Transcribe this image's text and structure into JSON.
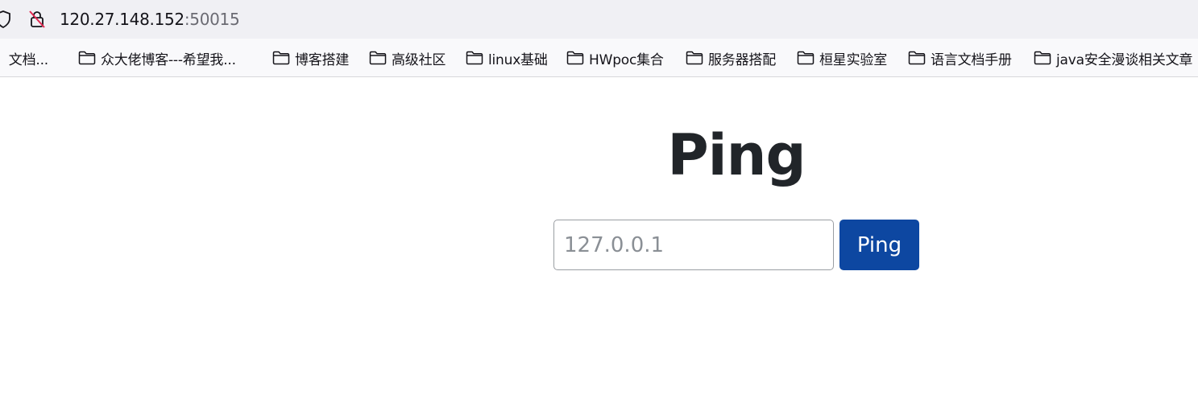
{
  "browser": {
    "url_host": "120.27.148.152",
    "url_port": ":50015",
    "bookmarks": [
      {
        "label": "、文档...",
        "icon": "none"
      },
      {
        "label": "众大佬博客---希望我...",
        "icon": "folder-icon"
      },
      {
        "label": "博客搭建",
        "icon": "folder-icon"
      },
      {
        "label": "高级社区",
        "icon": "folder-icon"
      },
      {
        "label": "linux基础",
        "icon": "folder-icon"
      },
      {
        "label": "HWpoc集合",
        "icon": "folder-icon"
      },
      {
        "label": "服务器搭配",
        "icon": "folder-icon"
      },
      {
        "label": "桓星实验室",
        "icon": "folder-icon"
      },
      {
        "label": "语言文档手册",
        "icon": "folder-icon"
      },
      {
        "label": "java安全漫谈相关文章",
        "icon": "folder-icon"
      }
    ]
  },
  "page": {
    "title": "Ping",
    "input_placeholder": "127.0.0.1",
    "button_label": "Ping"
  },
  "colors": {
    "button_bg": "#0d47a1",
    "title_text": "#212529"
  }
}
